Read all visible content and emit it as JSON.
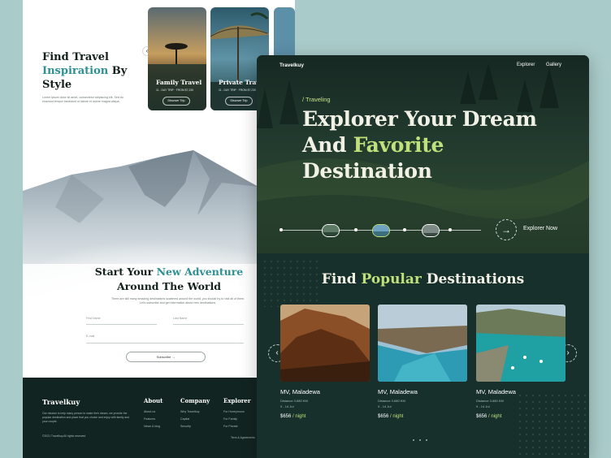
{
  "left": {
    "hero": {
      "title_part1": "Find Travel",
      "title_accent": "Inspiration",
      "title_part2": " By",
      "title_part3": "Style",
      "description": "Lorem ipsum dolor sit amet, consectetur adipiscing elit. Sed do eiusmod tempor incididunt ut labore et dolore magna aliqua.",
      "cards": [
        {
          "name": "Family Travel",
          "meta": "11 - DAY TRIP  ·  FROM $7,230",
          "button": "Discover Trip"
        },
        {
          "name": "Private Travel",
          "meta": "11 - DAY TRIP  ·  FROM $7,230",
          "button": "Discover Trip"
        }
      ]
    },
    "adventure": {
      "title_part1": "Start Your",
      "title_accent": "New Adventure",
      "title_line2": "Around The World",
      "description": "There are still many amazing destinations scattered around the world, you should try to visit all of them. Let's subscribe and get information about new destinations.",
      "first_name_placeholder": "First Name",
      "last_name_placeholder": "Last Name",
      "email_placeholder": "E-mail",
      "subscribe_label": "Subscribe"
    },
    "footer": {
      "brand": "Travelkuy",
      "description": "Our mission is help many person to make their dream, we provide the popular destination and place that you choice and enjoy with family and your couple.",
      "copyright": "©2021 Travelkuy.All rights reserved",
      "columns": [
        {
          "heading": "About",
          "items": [
            "About us",
            "Features",
            "News & blog"
          ]
        },
        {
          "heading": "Company",
          "items": [
            "Why Travelkuy",
            "Capital",
            "Security"
          ]
        },
        {
          "heading": "Explorer",
          "items": [
            "For Honeymoon",
            "For Family",
            "For Private"
          ]
        }
      ],
      "terms": "Term & Agreements"
    }
  },
  "right": {
    "brand": "Travelkuy",
    "nav": [
      "Explorer",
      "Gallery"
    ],
    "tag": "/ Traveling",
    "hero_line1": "Explorer Your Dream",
    "hero_line2_part1": "And ",
    "hero_line2_accent": "Favorite",
    "hero_line3": "Destination",
    "explore_label": "Explorer Now",
    "popular_part1": "Find ",
    "popular_accent": "Popular",
    "popular_part2": " Destinations",
    "destinations": [
      {
        "name": "MV, Maladewa",
        "distance": "Distance 3.680 KM",
        "dates": "9 - 14 Jul",
        "price": "$656",
        "per": " / night"
      },
      {
        "name": "MV, Maladewa",
        "distance": "Distance 3.680 KM",
        "dates": "9 - 14 Jul",
        "price": "$656",
        "per": " / night"
      },
      {
        "name": "MV, Maladewa",
        "distance": "Distance 3.680 KM",
        "dates": "9 - 14 Jul",
        "price": "$656",
        "per": " / night"
      }
    ]
  },
  "colors": {
    "background": "#a9cbc9",
    "dark_green": "#17302b",
    "accent_lime": "#bfe07a",
    "accent_teal": "#2f8f93"
  }
}
